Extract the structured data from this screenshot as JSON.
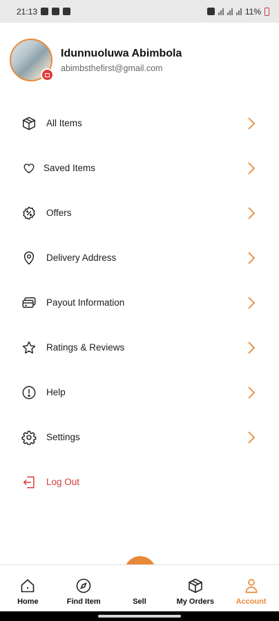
{
  "status_bar": {
    "time": "21:13",
    "battery": "11%"
  },
  "profile": {
    "name": "Idunnuoluwa Abimbola",
    "email": "abimbsthefirst@gmail.com"
  },
  "menu": [
    {
      "label": "All Items",
      "icon": "box-icon"
    },
    {
      "label": "Saved Items",
      "icon": "heart-icon"
    },
    {
      "label": "Offers",
      "icon": "offer-badge-icon"
    },
    {
      "label": "Delivery Address",
      "icon": "location-pin-icon"
    },
    {
      "label": "Payout Information",
      "icon": "card-icon"
    },
    {
      "label": "Ratings & Reviews",
      "icon": "star-icon"
    },
    {
      "label": "Help",
      "icon": "alert-circle-icon"
    },
    {
      "label": "Settings",
      "icon": "gear-icon"
    }
  ],
  "logout": {
    "label": "Log Out",
    "color": "#d63a3a"
  },
  "bottom_nav": [
    {
      "label": "Home",
      "icon": "home-icon"
    },
    {
      "label": "Find Item",
      "icon": "compass-icon"
    },
    {
      "label": "Sell",
      "icon": "store-icon"
    },
    {
      "label": "My Orders",
      "icon": "box-icon"
    },
    {
      "label": "Account",
      "icon": "person-icon",
      "active": true
    }
  ],
  "colors": {
    "accent": "#e8893a",
    "danger": "#d63a3a",
    "badge": "#e23b3b"
  }
}
